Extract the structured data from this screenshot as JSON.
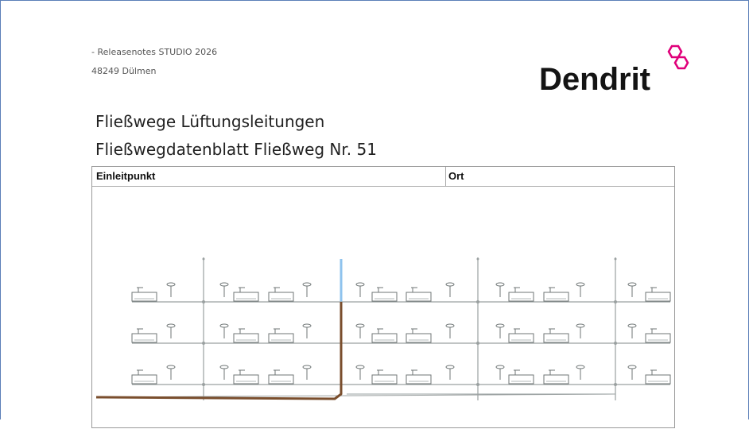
{
  "header": {
    "line1": "- Releasenotes STUDIO 2026",
    "line2": "48249 Dülmen"
  },
  "logo": {
    "text": "Dendrit",
    "accent_color": "#e0007a",
    "icon": "hexagon-logo-icon"
  },
  "titles": {
    "title1": "Fließwege Lüftungsleitungen",
    "title2": "Fließwegdatenblatt Fließweg Nr. 51"
  },
  "table": {
    "col1": "Einleitpunkt",
    "col2": "Ort"
  },
  "diagram": {
    "highlight_path_color": "#7a4e2d",
    "highlight_riser_color": "#8fc3ee",
    "pipe_color": "#9aa0a0"
  }
}
